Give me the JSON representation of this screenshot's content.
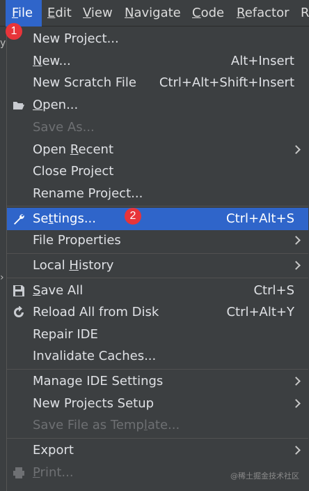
{
  "menubar": {
    "items": [
      {
        "pre": "",
        "u": "F",
        "post": "ile"
      },
      {
        "pre": "",
        "u": "E",
        "post": "dit"
      },
      {
        "pre": "",
        "u": "V",
        "post": "iew"
      },
      {
        "pre": "",
        "u": "N",
        "post": "avigate"
      },
      {
        "pre": "",
        "u": "C",
        "post": "ode"
      },
      {
        "pre": "",
        "u": "R",
        "post": "efactor"
      },
      {
        "pre": "",
        "u": "",
        "post": "R"
      }
    ]
  },
  "ide_left": {
    "stub1": "y",
    "stub2": "›"
  },
  "menu": {
    "new_project": "New Project...",
    "new": {
      "pre": "",
      "u": "N",
      "post": "ew..."
    },
    "new_shortcut": "Alt+Insert",
    "new_scratch": "New Scratch File",
    "new_scratch_shortcut": "Ctrl+Alt+Shift+Insert",
    "open": {
      "pre": "",
      "u": "O",
      "post": "pen..."
    },
    "save_as": "Save As...",
    "open_recent": {
      "pre": "Open ",
      "u": "R",
      "post": "ecent"
    },
    "close_project": "Close Project",
    "rename_project": "Rename Project...",
    "settings": {
      "pre": "Se",
      "u": "t",
      "post": "tings..."
    },
    "settings_shortcut": "Ctrl+Alt+S",
    "file_properties": "File Properties",
    "local_history": {
      "pre": "Local ",
      "u": "H",
      "post": "istory"
    },
    "save_all": {
      "pre": "",
      "u": "S",
      "post": "ave All"
    },
    "save_all_shortcut": "Ctrl+S",
    "reload": "Reload All from Disk",
    "reload_shortcut": "Ctrl+Alt+Y",
    "repair": "Repair IDE",
    "invalidate": "Invalidate Caches...",
    "manage_ide": "Manage IDE Settings",
    "new_projects_setup": "New Projects Setup",
    "save_template": {
      "pre": "Save File as Temp",
      "u": "l",
      "post": "ate..."
    },
    "export": "Export",
    "print": {
      "pre": "",
      "u": "P",
      "post": "rint..."
    }
  },
  "badges": {
    "one": "1",
    "two": "2"
  },
  "watermark": "@稀土掘金技术社区",
  "colors": {
    "highlight": "#2f65ca",
    "badge": "#e8343a",
    "menu_bg": "#3c3f41"
  }
}
